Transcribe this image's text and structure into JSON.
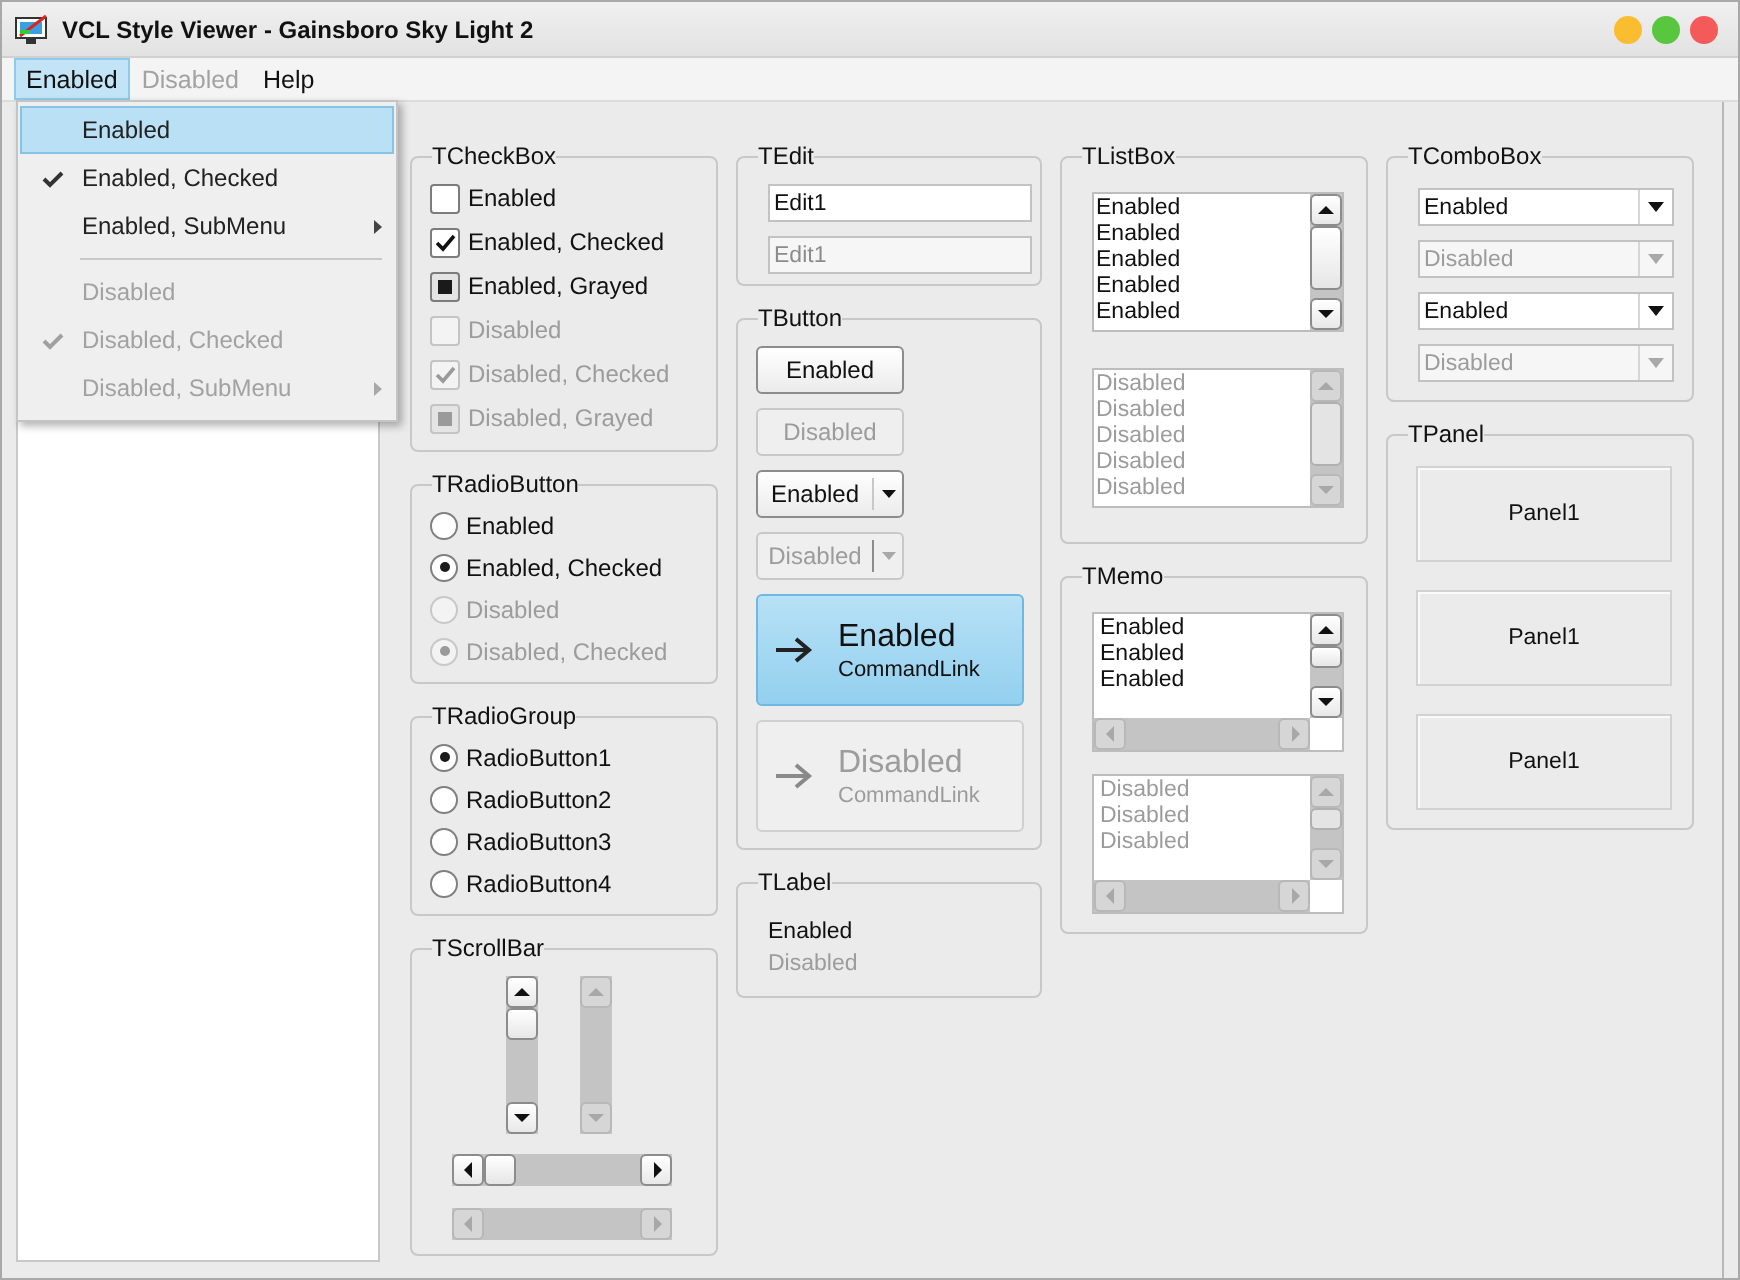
{
  "window": {
    "title": "VCL Style Viewer - Gainsboro Sky Light 2"
  },
  "menu_bar": [
    {
      "label": "Enabled",
      "selected": true,
      "disabled": false
    },
    {
      "label": "Disabled",
      "selected": false,
      "disabled": true
    },
    {
      "label": "Help",
      "selected": false,
      "disabled": false
    }
  ],
  "dropdown_menu": [
    {
      "kind": "item",
      "label": "Enabled",
      "selected": true,
      "checked": false,
      "disabled": false,
      "submenu": false
    },
    {
      "kind": "item",
      "label": "Enabled, Checked",
      "selected": false,
      "checked": true,
      "disabled": false,
      "submenu": false
    },
    {
      "kind": "item",
      "label": "Enabled, SubMenu",
      "selected": false,
      "checked": false,
      "disabled": false,
      "submenu": true
    },
    {
      "kind": "separator"
    },
    {
      "kind": "item",
      "label": "Disabled",
      "selected": false,
      "checked": false,
      "disabled": true,
      "submenu": false
    },
    {
      "kind": "item",
      "label": "Disabled, Checked",
      "selected": false,
      "checked": true,
      "disabled": true,
      "submenu": false
    },
    {
      "kind": "item",
      "label": "Disabled, SubMenu",
      "selected": false,
      "checked": false,
      "disabled": true,
      "submenu": true
    }
  ],
  "columns": [
    {
      "groups": [
        {
          "kind": "checkbox",
          "title": "TCheckBox",
          "items": [
            {
              "label": "Enabled",
              "checked": false,
              "grayed": false,
              "disabled": false
            },
            {
              "label": "Enabled, Checked",
              "checked": true,
              "grayed": false,
              "disabled": false
            },
            {
              "label": "Enabled, Grayed",
              "checked": false,
              "grayed": true,
              "disabled": false
            },
            {
              "label": "Disabled",
              "checked": false,
              "grayed": false,
              "disabled": true
            },
            {
              "label": "Disabled, Checked",
              "checked": true,
              "grayed": false,
              "disabled": true
            },
            {
              "label": "Disabled, Grayed",
              "checked": false,
              "grayed": true,
              "disabled": true
            }
          ]
        },
        {
          "kind": "radio",
          "title": "TRadioButton",
          "items": [
            {
              "label": "Enabled",
              "selected": false,
              "disabled": false
            },
            {
              "label": "Enabled, Checked",
              "selected": true,
              "disabled": false
            },
            {
              "label": "Disabled",
              "selected": false,
              "disabled": true
            },
            {
              "label": "Disabled, Checked",
              "selected": true,
              "disabled": true
            }
          ]
        },
        {
          "kind": "radio",
          "title": "TRadioGroup",
          "items": [
            {
              "label": "RadioButton1",
              "selected": true,
              "disabled": false
            },
            {
              "label": "RadioButton2",
              "selected": false,
              "disabled": false
            },
            {
              "label": "RadioButton3",
              "selected": false,
              "disabled": false
            },
            {
              "label": "RadioButton4",
              "selected": false,
              "disabled": false
            }
          ]
        },
        {
          "kind": "scrollbar",
          "title": "TScrollBar",
          "vertical_scrollbars": [
            {
              "disabled": false
            },
            {
              "disabled": true
            }
          ],
          "horizontal_scrollbars": [
            {
              "disabled": false
            },
            {
              "disabled": true
            }
          ]
        }
      ]
    },
    {
      "groups": [
        {
          "kind": "edit",
          "title": "TEdit",
          "fields": [
            {
              "value": "Edit1",
              "disabled": false
            },
            {
              "value": "Edit1",
              "disabled": true
            }
          ]
        },
        {
          "kind": "button",
          "title": "TButton",
          "buttons": [
            {
              "kind": "push",
              "label": "Enabled",
              "disabled": false
            },
            {
              "kind": "push",
              "label": "Disabled",
              "disabled": true
            },
            {
              "kind": "split",
              "label": "Enabled",
              "disabled": false
            },
            {
              "kind": "split",
              "label": "Disabled",
              "disabled": true
            },
            {
              "kind": "command_link",
              "label": "Enabled",
              "note": "CommandLink",
              "disabled": false
            },
            {
              "kind": "command_link",
              "label": "Disabled",
              "note": "CommandLink",
              "disabled": true
            }
          ]
        },
        {
          "kind": "label",
          "title": "TLabel",
          "labels": [
            {
              "text": "Enabled",
              "disabled": false
            },
            {
              "text": "Disabled",
              "disabled": true
            }
          ]
        }
      ]
    },
    {
      "groups": [
        {
          "kind": "listbox",
          "title": "TListBox",
          "lists": [
            {
              "items": [
                "Enabled",
                "Enabled",
                "Enabled",
                "Enabled",
                "Enabled"
              ],
              "disabled": false
            },
            {
              "items": [
                "Disabled",
                "Disabled",
                "Disabled",
                "Disabled",
                "Disabled"
              ],
              "disabled": true
            }
          ]
        },
        {
          "kind": "memo",
          "title": "TMemo",
          "memos": [
            {
              "lines": [
                "Enabled",
                "Enabled",
                "Enabled"
              ],
              "disabled": false
            },
            {
              "lines": [
                "Disabled",
                "Disabled",
                "Disabled"
              ],
              "disabled": true
            }
          ]
        }
      ]
    },
    {
      "groups": [
        {
          "kind": "combobox",
          "title": "TComboBox",
          "combos": [
            {
              "value": "Enabled",
              "disabled": false
            },
            {
              "value": "Disabled",
              "disabled": true
            },
            {
              "value": "Enabled",
              "disabled": false
            },
            {
              "value": "Disabled",
              "disabled": true
            }
          ]
        },
        {
          "kind": "panel",
          "title": "TPanel",
          "panels": [
            {
              "caption": "Panel1"
            },
            {
              "caption": "Panel1"
            },
            {
              "caption": "Panel1"
            }
          ]
        }
      ]
    }
  ]
}
